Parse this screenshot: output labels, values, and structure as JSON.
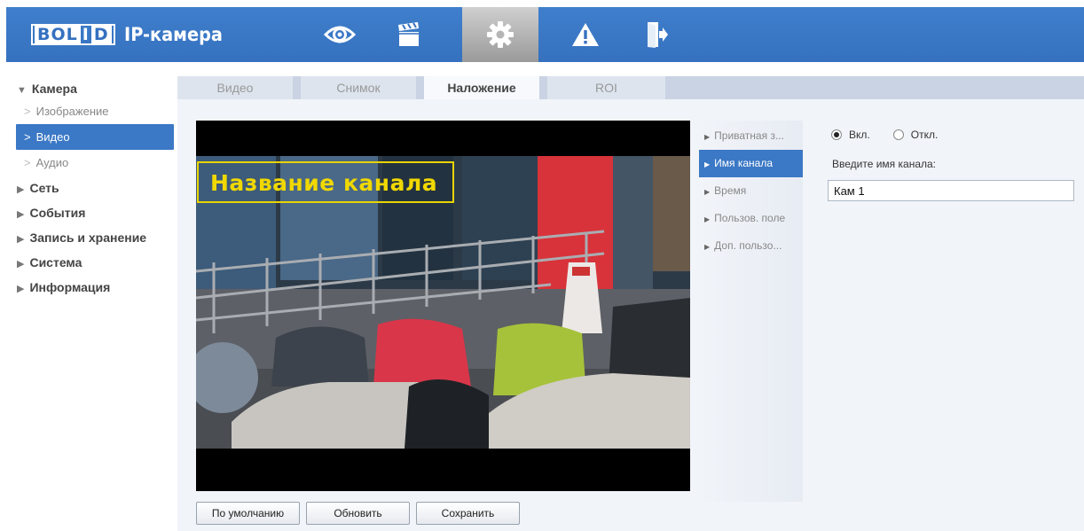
{
  "header": {
    "logo_text": "BOLID",
    "logo_part1": "BOL",
    "logo_part2": "I",
    "logo_part3": "D",
    "title": "IP-камера",
    "nav_icons": [
      "eye-icon",
      "clapperboard-icon",
      "gear-icon",
      "warning-icon",
      "exit-icon"
    ],
    "active_nav": "gear-icon",
    "color": "#3571bf"
  },
  "sidebar": {
    "sections": [
      {
        "label": "Камера",
        "expanded": true
      },
      {
        "label": "Сеть"
      },
      {
        "label": "События"
      },
      {
        "label": "Запись и хранение"
      },
      {
        "label": "Система"
      },
      {
        "label": "Информация"
      }
    ],
    "camera_items": [
      {
        "label": "Изображение"
      },
      {
        "label": "Видео",
        "active": true
      },
      {
        "label": "Аудио"
      }
    ]
  },
  "tabs": [
    {
      "label": "Видео"
    },
    {
      "label": "Снимок"
    },
    {
      "label": "Наложение",
      "active": true
    },
    {
      "label": "ROI"
    }
  ],
  "video": {
    "osd_text": "Название канала"
  },
  "overlay_menu": [
    {
      "label": "Приватная з..."
    },
    {
      "label": "Имя канала",
      "active": true
    },
    {
      "label": "Время"
    },
    {
      "label": "Пользов. поле"
    },
    {
      "label": "Доп. пользо..."
    }
  ],
  "settings": {
    "on_label": "Вкл.",
    "off_label": "Откл.",
    "selected": "on",
    "channel_name_label": "Введите имя канала:",
    "channel_name_value": "Кам 1"
  },
  "buttons": {
    "default": "По умолчанию",
    "refresh": "Обновить",
    "save": "Сохранить"
  },
  "colors": {
    "accent": "#3b78c5",
    "osd": "#f0d800"
  }
}
